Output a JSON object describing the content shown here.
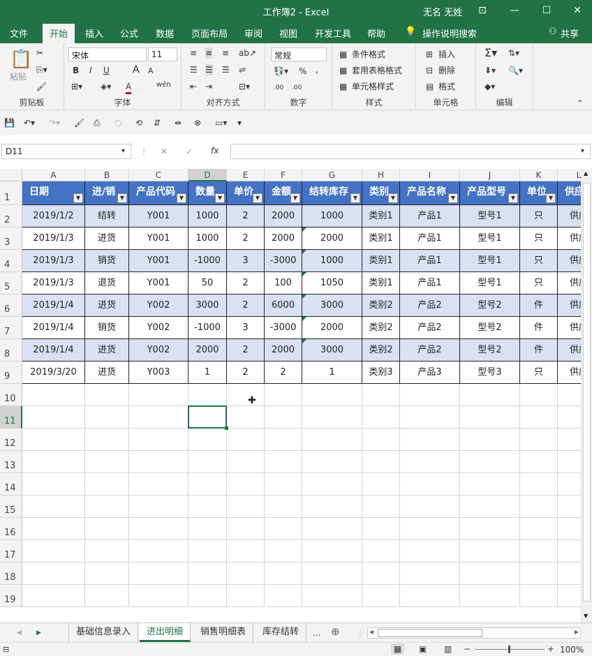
{
  "titlebar": {
    "title": "工作簿2  -  Excel",
    "user": "无名 无姓"
  },
  "tabs": [
    "文件",
    "开始",
    "插入",
    "公式",
    "数据",
    "页面布局",
    "审阅",
    "视图",
    "开发工具",
    "帮助"
  ],
  "active_tab": "开始",
  "tellme": "操作说明搜索",
  "share": "共享",
  "ribbon": {
    "clipboard": {
      "label": "剪贴板",
      "paste": "粘贴"
    },
    "font": {
      "label": "字体",
      "name": "宋体",
      "size": "11",
      "bold": "B",
      "italic": "I",
      "underline": "U",
      "grow": "A",
      "shrink": "A",
      "fontcolor": "A",
      "wen": "wén"
    },
    "align": {
      "label": "对齐方式"
    },
    "number": {
      "label": "数字",
      "format": "常规",
      "pct": "%",
      "comma": ",",
      "inc": ".00",
      "dec": ".00"
    },
    "styles": {
      "label": "样式",
      "cond": "条件格式",
      "table": "套用表格格式",
      "cell": "单元格样式"
    },
    "cells": {
      "label": "单元格",
      "insert": "插入",
      "delete": "删除",
      "format": "格式"
    },
    "editing": {
      "label": "编辑"
    }
  },
  "namebox": "D11",
  "fx": "fx",
  "columns": [
    "A",
    "B",
    "C",
    "D",
    "E",
    "F",
    "G",
    "H",
    "I",
    "J",
    "K",
    "L"
  ],
  "headers": [
    "日期",
    "进/销",
    "产品代码",
    "数量",
    "单价",
    "金额",
    "结转库存",
    "类别",
    "产品名称",
    "产品型号",
    "单位",
    "供应"
  ],
  "rows": [
    [
      "2019/1/2",
      "结转",
      "Y001",
      "1000",
      "2",
      "2000",
      "1000",
      "类别1",
      "产品1",
      "型号1",
      "只",
      "供应"
    ],
    [
      "2019/1/3",
      "进货",
      "Y001",
      "1000",
      "2",
      "2000",
      "2000",
      "类别1",
      "产品1",
      "型号1",
      "只",
      "供应"
    ],
    [
      "2019/1/3",
      "销货",
      "Y001",
      "-1000",
      "3",
      "-3000",
      "1000",
      "类别1",
      "产品1",
      "型号1",
      "只",
      "供应"
    ],
    [
      "2019/1/3",
      "退货",
      "Y001",
      "50",
      "2",
      "100",
      "1050",
      "类别1",
      "产品1",
      "型号1",
      "只",
      "供应"
    ],
    [
      "2019/1/4",
      "进货",
      "Y002",
      "3000",
      "2",
      "6000",
      "3000",
      "类别2",
      "产品2",
      "型号2",
      "件",
      "供应"
    ],
    [
      "2019/1/4",
      "销货",
      "Y002",
      "-1000",
      "3",
      "-3000",
      "2000",
      "类别2",
      "产品2",
      "型号2",
      "件",
      "供应"
    ],
    [
      "2019/1/4",
      "进货",
      "Y002",
      "2000",
      "2",
      "2000",
      "3000",
      "类别2",
      "产品2",
      "型号2",
      "件",
      "供应"
    ],
    [
      "2019/3/20",
      "进货",
      "Y003",
      "1",
      "2",
      "2",
      "1",
      "类别3",
      "产品3",
      "型号3",
      "只",
      "供应"
    ]
  ],
  "row_numbers": [
    "1",
    "2",
    "3",
    "4",
    "5",
    "6",
    "7",
    "8",
    "9",
    "10",
    "11",
    "12",
    "13",
    "14",
    "15",
    "16",
    "17",
    "18",
    "19"
  ],
  "sheet_tabs": [
    "基础信息录入",
    "进出明细",
    "销售明细表",
    "库存结转"
  ],
  "active_sheet": "进出明细",
  "more_tabs": "...",
  "zoom": "100%"
}
